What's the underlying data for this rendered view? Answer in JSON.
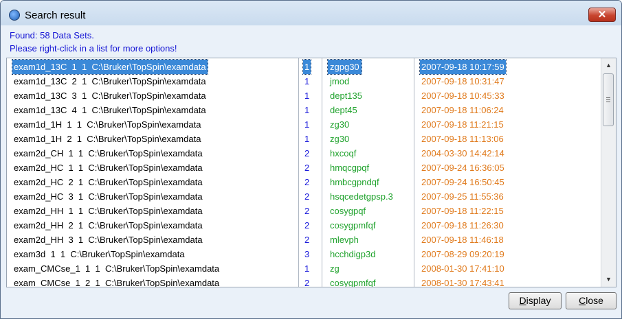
{
  "window": {
    "title": "Search result",
    "close_glyph": "✕"
  },
  "info": {
    "found": "Found: 58 Data Sets.",
    "hint": "Please right-click in a list for more options!"
  },
  "colors": {
    "dim": "#1a1adb",
    "pulprog": "#1fa22c",
    "date": "#e07a1c",
    "selection": "#3b89d8"
  },
  "rows": [
    {
      "path": "exam1d_13C  1  1  C:\\Bruker\\TopSpin\\examdata",
      "dim": "1",
      "pulprog": "zgpg30",
      "date": "2007-09-18 10:17:59",
      "selected": true
    },
    {
      "path": "exam1d_13C  2  1  C:\\Bruker\\TopSpin\\examdata",
      "dim": "1",
      "pulprog": "jmod",
      "date": "2007-09-18 10:31:47"
    },
    {
      "path": "exam1d_13C  3  1  C:\\Bruker\\TopSpin\\examdata",
      "dim": "1",
      "pulprog": "dept135",
      "date": "2007-09-18 10:45:33"
    },
    {
      "path": "exam1d_13C  4  1  C:\\Bruker\\TopSpin\\examdata",
      "dim": "1",
      "pulprog": "dept45",
      "date": "2007-09-18 11:06:24"
    },
    {
      "path": "exam1d_1H  1  1  C:\\Bruker\\TopSpin\\examdata",
      "dim": "1",
      "pulprog": "zg30",
      "date": "2007-09-18 11:21:15"
    },
    {
      "path": "exam1d_1H  2  1  C:\\Bruker\\TopSpin\\examdata",
      "dim": "1",
      "pulprog": "zg30",
      "date": "2007-09-18 11:13:06"
    },
    {
      "path": "exam2d_CH  1  1  C:\\Bruker\\TopSpin\\examdata",
      "dim": "2",
      "pulprog": "hxcoqf",
      "date": "2004-03-30 14:42:14"
    },
    {
      "path": "exam2d_HC  1  1  C:\\Bruker\\TopSpin\\examdata",
      "dim": "2",
      "pulprog": "hmqcgpqf",
      "date": "2007-09-24 16:36:05"
    },
    {
      "path": "exam2d_HC  2  1  C:\\Bruker\\TopSpin\\examdata",
      "dim": "2",
      "pulprog": "hmbcgpndqf",
      "date": "2007-09-24 16:50:45"
    },
    {
      "path": "exam2d_HC  3  1  C:\\Bruker\\TopSpin\\examdata",
      "dim": "2",
      "pulprog": "hsqcedetgpsp.3",
      "date": "2007-09-25 11:55:36"
    },
    {
      "path": "exam2d_HH  1  1  C:\\Bruker\\TopSpin\\examdata",
      "dim": "2",
      "pulprog": "cosygpqf",
      "date": "2007-09-18 11:22:15"
    },
    {
      "path": "exam2d_HH  2  1  C:\\Bruker\\TopSpin\\examdata",
      "dim": "2",
      "pulprog": "cosygpmfqf",
      "date": "2007-09-18 11:26:30"
    },
    {
      "path": "exam2d_HH  3  1  C:\\Bruker\\TopSpin\\examdata",
      "dim": "2",
      "pulprog": "mlevph",
      "date": "2007-09-18 11:46:18"
    },
    {
      "path": "exam3d  1  1  C:\\Bruker\\TopSpin\\examdata",
      "dim": "3",
      "pulprog": "hcchdigp3d",
      "date": "2007-08-29 09:20:19"
    },
    {
      "path": "exam_CMCse_1  1  1  C:\\Bruker\\TopSpin\\examdata",
      "dim": "1",
      "pulprog": "zg",
      "date": "2008-01-30 17:41:10"
    },
    {
      "path": "exam_CMCse_1  2  1  C:\\Bruker\\TopSpin\\examdata",
      "dim": "2",
      "pulprog": "cosygpmfqf",
      "date": "2008-01-30 17:43:41"
    }
  ],
  "buttons": {
    "display": "Display",
    "close": "Close"
  }
}
